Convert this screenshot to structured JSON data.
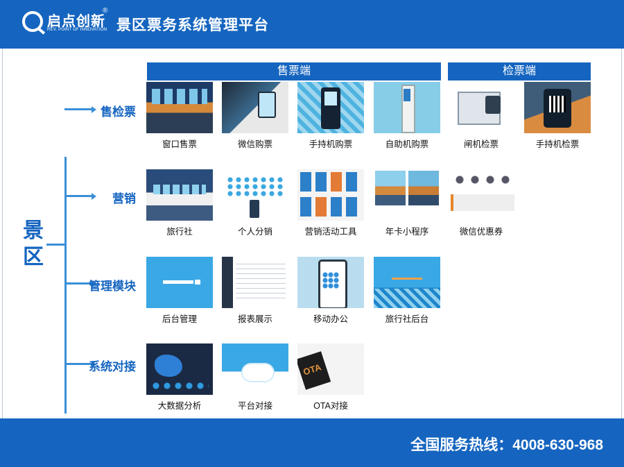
{
  "header": {
    "logo_text": "启点创新",
    "logo_subtext": "REV. POINT OF INNOVATION",
    "logo_mark": "®",
    "title": "景区票务系统管理平台"
  },
  "diagram": {
    "root": "景区",
    "group_headers": {
      "sales": "售票端",
      "check": "检票端"
    },
    "categories": [
      {
        "label": "售检票",
        "items": [
          {
            "label": "窗口售票",
            "icon": "window-counter-image"
          },
          {
            "label": "微信购票",
            "icon": "wechat-purchase-image"
          },
          {
            "label": "手持机购票",
            "icon": "handheld-terminal-image"
          },
          {
            "label": "自助机购票",
            "icon": "self-service-kiosk-image"
          },
          {
            "label": "闸机检票",
            "icon": "turnstile-gate-image"
          },
          {
            "label": "手持机检票",
            "icon": "handheld-scanner-image"
          }
        ]
      },
      {
        "label": "营销",
        "items": [
          {
            "label": "旅行社",
            "icon": "travel-agency-image"
          },
          {
            "label": "个人分销",
            "icon": "distribution-network-image"
          },
          {
            "label": "营销活动工具",
            "icon": "marketing-tools-image"
          },
          {
            "label": "年卡小程序",
            "icon": "annual-card-app-image"
          },
          {
            "label": "微信优惠券",
            "icon": "wechat-coupon-image"
          }
        ]
      },
      {
        "label": "管理模块",
        "items": [
          {
            "label": "后台管理",
            "icon": "admin-login-image"
          },
          {
            "label": "报表展示",
            "icon": "report-table-image"
          },
          {
            "label": "移动办公",
            "icon": "mobile-office-image"
          },
          {
            "label": "旅行社后台",
            "icon": "agency-backend-image"
          }
        ]
      },
      {
        "label": "系统对接",
        "items": [
          {
            "label": "大数据分析",
            "icon": "big-data-dashboard-image"
          },
          {
            "label": "平台对接",
            "icon": "cloud-platform-image"
          },
          {
            "label": "OTA对接",
            "icon": "ota-partners-image"
          }
        ]
      }
    ]
  },
  "footer": {
    "hotline": "全国服务热线：4008-630-968"
  },
  "colors": {
    "primary": "#1565c0",
    "connector": "#3a8fd8"
  }
}
